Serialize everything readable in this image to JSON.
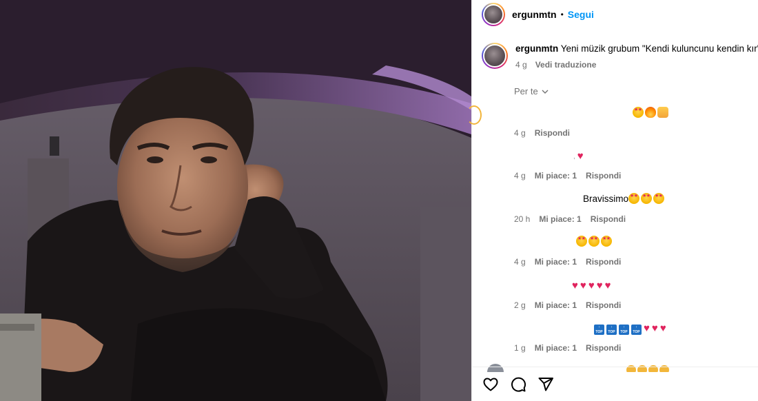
{
  "post": {
    "username": "ergunmtn",
    "separator": "•",
    "follow_label": "Segui"
  },
  "caption": {
    "username": "ergunmtn",
    "text": "Yeni müzik grubum \"Kendi kuluncunu kendin kır\"",
    "time": "4 g",
    "translate_label": "Vedi traduzione"
  },
  "sort": {
    "label": "Per te"
  },
  "comments": [
    {
      "text": "",
      "emojis": [
        "star-struck",
        "fire",
        "raising-hands"
      ],
      "time": "4 g",
      "likes": "",
      "reply_label": "Rispondi"
    },
    {
      "text": ",",
      "emojis": [
        "heart"
      ],
      "time": "4 g",
      "likes": "Mi piace: 1",
      "reply_label": "Rispondi"
    },
    {
      "text": "Bravissimo",
      "emojis": [
        "star-struck",
        "star-struck",
        "star-struck"
      ],
      "time": "20 h",
      "likes": "Mi piace: 1",
      "reply_label": "Rispondi"
    },
    {
      "text": "",
      "emojis": [
        "star-struck",
        "star-struck",
        "star-struck"
      ],
      "time": "4 g",
      "likes": "Mi piace: 1",
      "reply_label": "Rispondi"
    },
    {
      "text": "",
      "emojis": [
        "heart",
        "heart",
        "heart",
        "heart",
        "heart"
      ],
      "time": "2 g",
      "likes": "Mi piace: 1",
      "reply_label": "Rispondi"
    },
    {
      "text": "",
      "emojis": [
        "top",
        "top",
        "top",
        "top",
        "heart",
        "heart",
        "heart"
      ],
      "time": "1 g",
      "likes": "Mi piace: 1",
      "reply_label": "Rispondi"
    }
  ],
  "actions": {
    "like_icon": "heart-outline-icon",
    "comment_icon": "comment-bubble-icon",
    "share_icon": "paper-plane-icon"
  },
  "colors": {
    "accent": "#0095f6",
    "muted": "#737373",
    "heart": "#e0245e"
  }
}
